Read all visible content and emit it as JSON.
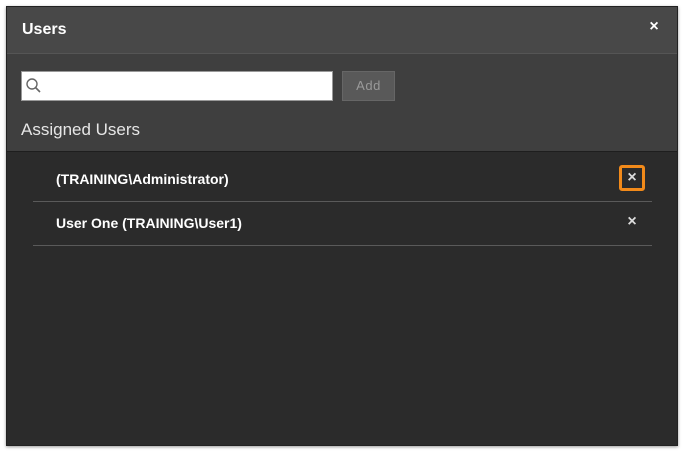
{
  "dialog": {
    "title": "Users",
    "close_label": "×"
  },
  "search": {
    "value": "",
    "placeholder": "",
    "add_label": "Add"
  },
  "assigned": {
    "heading": "Assigned Users",
    "users": [
      {
        "label": "(TRAINING\\Administrator)",
        "remove_label": "×",
        "highlighted": true
      },
      {
        "label": "User One (TRAINING\\User1)",
        "remove_label": "×",
        "highlighted": false
      }
    ]
  },
  "colors": {
    "dialog_bg": "#3f3f3f",
    "list_bg": "#2b2b2b",
    "highlight": "#f28a1a"
  },
  "icons": {
    "search": "search-icon",
    "close": "close-icon",
    "remove": "remove-icon"
  }
}
